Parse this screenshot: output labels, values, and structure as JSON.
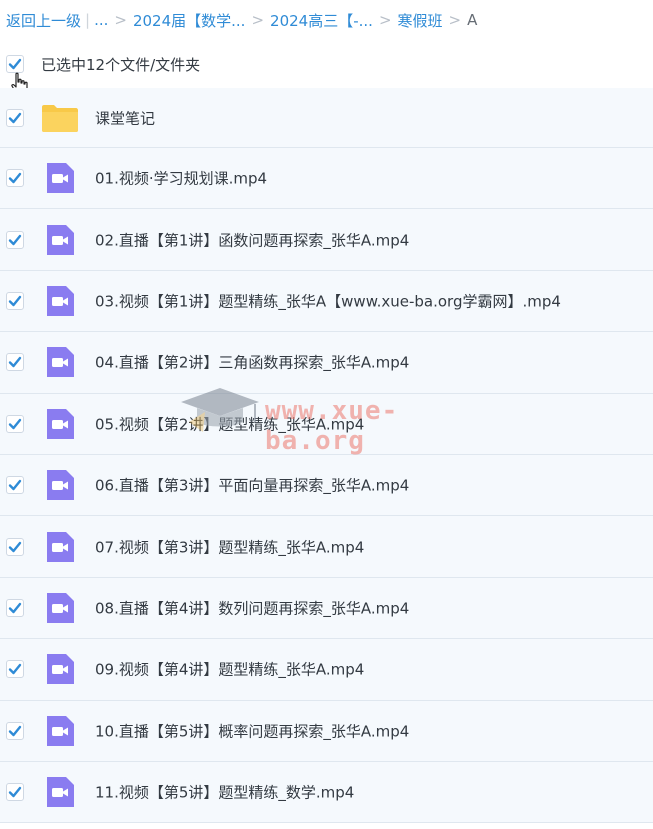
{
  "breadcrumb": {
    "back": "返回上一级",
    "ellipsis": "...",
    "crumb1": "2024届【数学...",
    "crumb2": "2024高三【-...",
    "crumb3": "寒假班",
    "current": "A",
    "separator": ">"
  },
  "selection": {
    "label": "已选中12个文件/文件夹",
    "checked": true
  },
  "files": [
    {
      "name": "课堂笔记",
      "type": "folder",
      "checked": true
    },
    {
      "name": "01.视频·学习规划课.mp4",
      "type": "video",
      "checked": true
    },
    {
      "name": "02.直播【第1讲】函数问题再探索_张华A.mp4",
      "type": "video",
      "checked": true
    },
    {
      "name": "03.视频【第1讲】题型精练_张华A【www.xue-ba.org学霸网】.mp4",
      "type": "video",
      "checked": true
    },
    {
      "name": "04.直播【第2讲】三角函数再探索_张华A.mp4",
      "type": "video",
      "checked": true
    },
    {
      "name": "05.视频【第2讲】题型精练_张华A.mp4",
      "type": "video",
      "checked": true
    },
    {
      "name": "06.直播【第3讲】平面向量再探索_张华A.mp4",
      "type": "video",
      "checked": true
    },
    {
      "name": "07.视频【第3讲】题型精练_张华A.mp4",
      "type": "video",
      "checked": true
    },
    {
      "name": "08.直播【第4讲】数列问题再探索_张华A.mp4",
      "type": "video",
      "checked": true
    },
    {
      "name": "09.视频【第4讲】题型精练_张华A.mp4",
      "type": "video",
      "checked": true
    },
    {
      "name": "10.直播【第5讲】概率问题再探索_张华A.mp4",
      "type": "video",
      "checked": true
    },
    {
      "name": "11.视频【第5讲】题型精练_数学.mp4",
      "type": "video",
      "checked": true
    }
  ],
  "watermark": {
    "text": "www.xue-ba.org"
  },
  "colors": {
    "link": "#2f8bd6",
    "checkbox": "#2f8bd6",
    "folder": "#f8c948",
    "video": "#8a7cf0",
    "row_bg": "#f5f9fd"
  }
}
